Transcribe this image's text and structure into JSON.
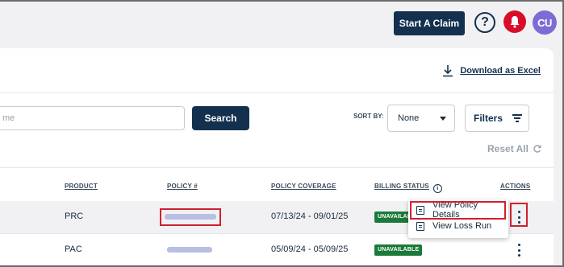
{
  "header": {
    "claim_button": "Start A Claim",
    "help_icon": "question-circle-icon",
    "bell_icon": "bell-icon",
    "avatar_initials": "CU"
  },
  "toolbar": {
    "download_label": "Download as Excel",
    "search_placeholder": "me",
    "search_button": "Search",
    "sort_label": "SORT BY:",
    "sort_value": "None",
    "filters_label": "Filters",
    "reset_label": "Reset All"
  },
  "table": {
    "columns": [
      "PRODUCT",
      "POLICY #",
      "POLICY COVERAGE",
      "BILLING STATUS",
      "ACTIONS"
    ],
    "rows": [
      {
        "product": "PRC",
        "policy": "",
        "coverage": "07/13/24 - 09/01/25",
        "status": "UNAVAILABLE"
      },
      {
        "product": "PAC",
        "policy": "",
        "coverage": "05/09/24 - 05/09/25",
        "status": "UNAVAILABLE"
      }
    ]
  },
  "menu": {
    "items": [
      "View Policy Details",
      "View Loss Run"
    ]
  },
  "colors": {
    "primary": "#14304f",
    "notification": "#d80d2a",
    "avatar": "#7e6bd6",
    "status_badge": "#1b7a3a",
    "highlight": "#d0202f"
  }
}
